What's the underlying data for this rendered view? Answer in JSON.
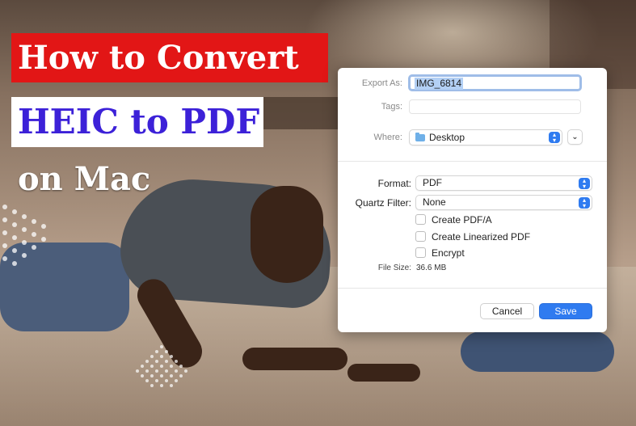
{
  "banner": {
    "line1": "How to Convert",
    "line2": "HEIC to PDF",
    "line3": "on Mac",
    "colors": {
      "line1_bg": "#e21616",
      "line1_text": "#ffffff",
      "line2_bg": "#ffffff",
      "line2_text": "#3c21d8",
      "line3_text": "#ffffff"
    }
  },
  "dialog": {
    "export_as_label": "Export As:",
    "export_as_value": "IMG_6814",
    "tags_label": "Tags:",
    "tags_value": "",
    "where_label": "Where:",
    "where_value": "Desktop",
    "where_icon": "folder-icon",
    "format_label": "Format:",
    "format_value": "PDF",
    "quartz_label": "Quartz Filter:",
    "quartz_value": "None",
    "options": [
      {
        "label": "Create PDF/A",
        "checked": false
      },
      {
        "label": "Create Linearized PDF",
        "checked": false
      },
      {
        "label": "Encrypt",
        "checked": false
      }
    ],
    "file_size_label": "File Size:",
    "file_size_value": "36.6 MB",
    "cancel_label": "Cancel",
    "save_label": "Save",
    "accent_color": "#2f7bf0"
  }
}
